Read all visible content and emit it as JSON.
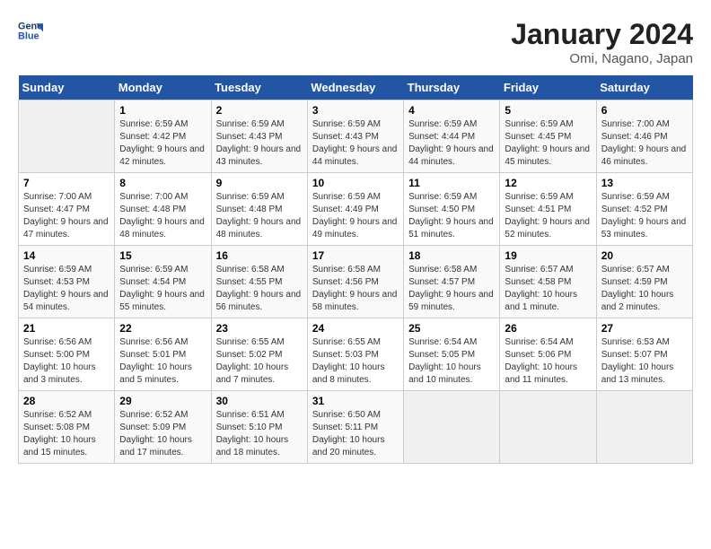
{
  "header": {
    "logo_line1": "General",
    "logo_line2": "Blue",
    "month": "January 2024",
    "location": "Omi, Nagano, Japan"
  },
  "weekdays": [
    "Sunday",
    "Monday",
    "Tuesday",
    "Wednesday",
    "Thursday",
    "Friday",
    "Saturday"
  ],
  "weeks": [
    [
      {
        "day": "",
        "sunrise": "",
        "sunset": "",
        "daylight": ""
      },
      {
        "day": "1",
        "sunrise": "Sunrise: 6:59 AM",
        "sunset": "Sunset: 4:42 PM",
        "daylight": "Daylight: 9 hours and 42 minutes."
      },
      {
        "day": "2",
        "sunrise": "Sunrise: 6:59 AM",
        "sunset": "Sunset: 4:43 PM",
        "daylight": "Daylight: 9 hours and 43 minutes."
      },
      {
        "day": "3",
        "sunrise": "Sunrise: 6:59 AM",
        "sunset": "Sunset: 4:43 PM",
        "daylight": "Daylight: 9 hours and 44 minutes."
      },
      {
        "day": "4",
        "sunrise": "Sunrise: 6:59 AM",
        "sunset": "Sunset: 4:44 PM",
        "daylight": "Daylight: 9 hours and 44 minutes."
      },
      {
        "day": "5",
        "sunrise": "Sunrise: 6:59 AM",
        "sunset": "Sunset: 4:45 PM",
        "daylight": "Daylight: 9 hours and 45 minutes."
      },
      {
        "day": "6",
        "sunrise": "Sunrise: 7:00 AM",
        "sunset": "Sunset: 4:46 PM",
        "daylight": "Daylight: 9 hours and 46 minutes."
      }
    ],
    [
      {
        "day": "7",
        "sunrise": "Sunrise: 7:00 AM",
        "sunset": "Sunset: 4:47 PM",
        "daylight": "Daylight: 9 hours and 47 minutes."
      },
      {
        "day": "8",
        "sunrise": "Sunrise: 7:00 AM",
        "sunset": "Sunset: 4:48 PM",
        "daylight": "Daylight: 9 hours and 48 minutes."
      },
      {
        "day": "9",
        "sunrise": "Sunrise: 6:59 AM",
        "sunset": "Sunset: 4:48 PM",
        "daylight": "Daylight: 9 hours and 48 minutes."
      },
      {
        "day": "10",
        "sunrise": "Sunrise: 6:59 AM",
        "sunset": "Sunset: 4:49 PM",
        "daylight": "Daylight: 9 hours and 49 minutes."
      },
      {
        "day": "11",
        "sunrise": "Sunrise: 6:59 AM",
        "sunset": "Sunset: 4:50 PM",
        "daylight": "Daylight: 9 hours and 51 minutes."
      },
      {
        "day": "12",
        "sunrise": "Sunrise: 6:59 AM",
        "sunset": "Sunset: 4:51 PM",
        "daylight": "Daylight: 9 hours and 52 minutes."
      },
      {
        "day": "13",
        "sunrise": "Sunrise: 6:59 AM",
        "sunset": "Sunset: 4:52 PM",
        "daylight": "Daylight: 9 hours and 53 minutes."
      }
    ],
    [
      {
        "day": "14",
        "sunrise": "Sunrise: 6:59 AM",
        "sunset": "Sunset: 4:53 PM",
        "daylight": "Daylight: 9 hours and 54 minutes."
      },
      {
        "day": "15",
        "sunrise": "Sunrise: 6:59 AM",
        "sunset": "Sunset: 4:54 PM",
        "daylight": "Daylight: 9 hours and 55 minutes."
      },
      {
        "day": "16",
        "sunrise": "Sunrise: 6:58 AM",
        "sunset": "Sunset: 4:55 PM",
        "daylight": "Daylight: 9 hours and 56 minutes."
      },
      {
        "day": "17",
        "sunrise": "Sunrise: 6:58 AM",
        "sunset": "Sunset: 4:56 PM",
        "daylight": "Daylight: 9 hours and 58 minutes."
      },
      {
        "day": "18",
        "sunrise": "Sunrise: 6:58 AM",
        "sunset": "Sunset: 4:57 PM",
        "daylight": "Daylight: 9 hours and 59 minutes."
      },
      {
        "day": "19",
        "sunrise": "Sunrise: 6:57 AM",
        "sunset": "Sunset: 4:58 PM",
        "daylight": "Daylight: 10 hours and 1 minute."
      },
      {
        "day": "20",
        "sunrise": "Sunrise: 6:57 AM",
        "sunset": "Sunset: 4:59 PM",
        "daylight": "Daylight: 10 hours and 2 minutes."
      }
    ],
    [
      {
        "day": "21",
        "sunrise": "Sunrise: 6:56 AM",
        "sunset": "Sunset: 5:00 PM",
        "daylight": "Daylight: 10 hours and 3 minutes."
      },
      {
        "day": "22",
        "sunrise": "Sunrise: 6:56 AM",
        "sunset": "Sunset: 5:01 PM",
        "daylight": "Daylight: 10 hours and 5 minutes."
      },
      {
        "day": "23",
        "sunrise": "Sunrise: 6:55 AM",
        "sunset": "Sunset: 5:02 PM",
        "daylight": "Daylight: 10 hours and 7 minutes."
      },
      {
        "day": "24",
        "sunrise": "Sunrise: 6:55 AM",
        "sunset": "Sunset: 5:03 PM",
        "daylight": "Daylight: 10 hours and 8 minutes."
      },
      {
        "day": "25",
        "sunrise": "Sunrise: 6:54 AM",
        "sunset": "Sunset: 5:05 PM",
        "daylight": "Daylight: 10 hours and 10 minutes."
      },
      {
        "day": "26",
        "sunrise": "Sunrise: 6:54 AM",
        "sunset": "Sunset: 5:06 PM",
        "daylight": "Daylight: 10 hours and 11 minutes."
      },
      {
        "day": "27",
        "sunrise": "Sunrise: 6:53 AM",
        "sunset": "Sunset: 5:07 PM",
        "daylight": "Daylight: 10 hours and 13 minutes."
      }
    ],
    [
      {
        "day": "28",
        "sunrise": "Sunrise: 6:52 AM",
        "sunset": "Sunset: 5:08 PM",
        "daylight": "Daylight: 10 hours and 15 minutes."
      },
      {
        "day": "29",
        "sunrise": "Sunrise: 6:52 AM",
        "sunset": "Sunset: 5:09 PM",
        "daylight": "Daylight: 10 hours and 17 minutes."
      },
      {
        "day": "30",
        "sunrise": "Sunrise: 6:51 AM",
        "sunset": "Sunset: 5:10 PM",
        "daylight": "Daylight: 10 hours and 18 minutes."
      },
      {
        "day": "31",
        "sunrise": "Sunrise: 6:50 AM",
        "sunset": "Sunset: 5:11 PM",
        "daylight": "Daylight: 10 hours and 20 minutes."
      },
      {
        "day": "",
        "sunrise": "",
        "sunset": "",
        "daylight": ""
      },
      {
        "day": "",
        "sunrise": "",
        "sunset": "",
        "daylight": ""
      },
      {
        "day": "",
        "sunrise": "",
        "sunset": "",
        "daylight": ""
      }
    ]
  ]
}
